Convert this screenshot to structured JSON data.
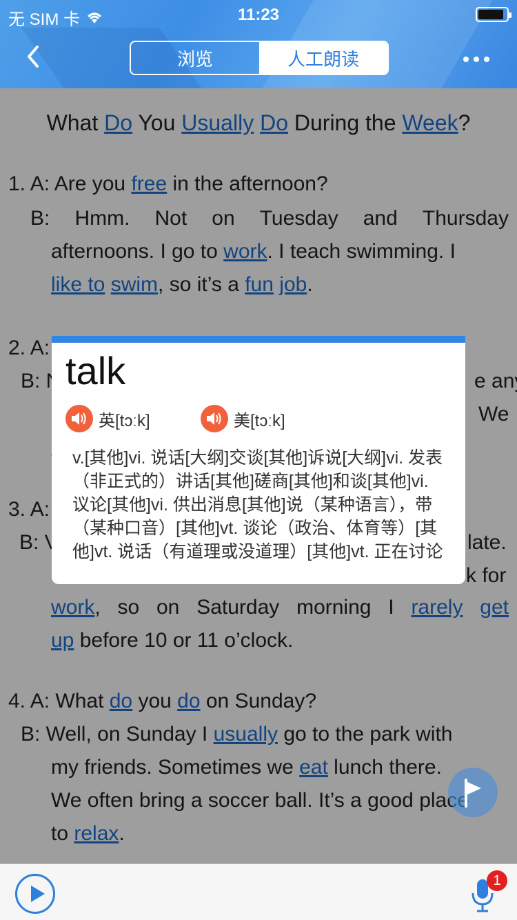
{
  "status_bar": {
    "carrier": "无 SIM 卡",
    "time": "11:23"
  },
  "header": {
    "tabs": {
      "browse": "浏览",
      "read": "人工朗读"
    }
  },
  "article": {
    "title": {
      "w1": "What",
      "w2": "Do",
      "w3": "You",
      "w4": "Usually",
      "w5": "Do",
      "w6": "During the",
      "w7": "Week",
      "w8": "?"
    },
    "p1": {
      "a_pre": "1. A: Are you ",
      "a_link": "free",
      "a_post": " in the afternoon?",
      "b_line1": [
        "B:",
        "Hmm.",
        "Not",
        "on",
        "Tuesday",
        "and",
        "Thursday"
      ],
      "b_line2_pre": "afternoons. I go to ",
      "b_line2_link": "work",
      "b_line2_post": ". I teach swimming. I",
      "b_line3_l1": "like to",
      "b_line3_l2": "swim",
      "b_line3_mid": ", so it’s a ",
      "b_line3_l3": "fun",
      "b_line3_l4": "job",
      "b_line3_end": "."
    },
    "p2": {
      "a_prefix": "2. A:",
      "b_prefix": "B: N",
      "frag1": "e any",
      "frag2": "We",
      "frag3": "v"
    },
    "p3": {
      "a_prefix": "3. A:",
      "b_prefix": "B: V",
      "frag1": "late.",
      "frag2": "k for"
    },
    "p3b": {
      "line2": [
        "work",
        ",",
        "so",
        "on",
        "Saturday",
        "morning",
        "I",
        "rarely",
        "get"
      ],
      "line3_link": "up",
      "line3_post": " before 10 or 11 o’clock."
    },
    "p4": {
      "a_pre": "4. A: What ",
      "a_l1": "do",
      "a_mid": " you ",
      "a_l2": "do",
      "a_post": " on Sunday?",
      "b1_pre": "B: Well, on Sunday I ",
      "b1_link": "usually",
      "b1_post": " go to the park with",
      "b2_pre": "my friends. Sometimes we ",
      "b2_link": "eat",
      "b2_post": " lunch there.",
      "b3": "We often bring a soccer ball. It’s a good place",
      "b4_pre": "to ",
      "b4_link": "relax",
      "b4_post": "."
    }
  },
  "popup": {
    "word": "talk",
    "uk_label": "英[tɔːk]",
    "us_label": "美[tɔːk]",
    "definitions": "v.[其他]vi. 说话[大纲]交谈[其他]诉说[大纲]vi. 发表（非正式的）讲话[其他]磋商[其他]和谈[其他]vi. 议论[其他]vi. 供出消息[其他]说（某种语言），带（某种口音）[其他]vt. 谈论（政治、体育等）[其他]vt. 说话（有道理或没道理）[其他]vt. 正在讨论"
  },
  "bottom": {
    "badge_count": "1"
  },
  "colors": {
    "accent": "#2f7fdc",
    "link": "#1f6fd1",
    "speaker": "#f2603c",
    "badge": "#e32020"
  }
}
